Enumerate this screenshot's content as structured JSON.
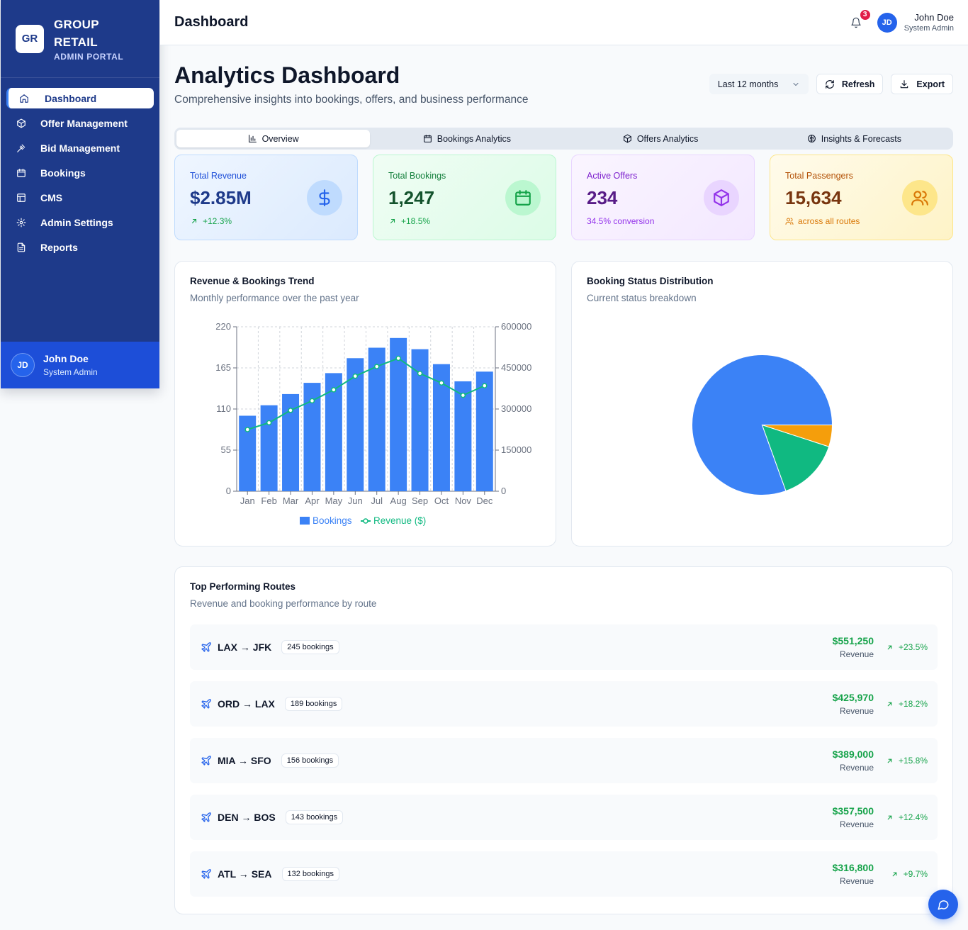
{
  "brand": {
    "logo": "GR",
    "name_line1": "GROUP",
    "name_line2": "RETAIL",
    "subtitle": "ADMIN PORTAL"
  },
  "sidebar": {
    "items": [
      {
        "label": "Dashboard",
        "icon": "home-icon",
        "active": true
      },
      {
        "label": "Offer Management",
        "icon": "package-icon"
      },
      {
        "label": "Bid Management",
        "icon": "gavel-icon"
      },
      {
        "label": "Bookings",
        "icon": "calendar-icon"
      },
      {
        "label": "CMS",
        "icon": "layout-icon"
      },
      {
        "label": "Admin Settings",
        "icon": "gear-icon"
      },
      {
        "label": "Reports",
        "icon": "file-icon"
      }
    ],
    "user": {
      "initials": "JD",
      "name": "John Doe",
      "role": "System Admin"
    }
  },
  "header": {
    "title": "Dashboard",
    "notifications": "3",
    "user": {
      "initials": "JD",
      "name": "John Doe",
      "role": "System Admin"
    }
  },
  "page": {
    "title": "Analytics Dashboard",
    "subtitle": "Comprehensive insights into bookings, offers, and business performance",
    "range_select": "Last 12 months",
    "refresh_label": "Refresh",
    "export_label": "Export"
  },
  "tabs": [
    {
      "label": "Overview",
      "icon": "bar-chart-icon",
      "active": true
    },
    {
      "label": "Bookings Analytics",
      "icon": "calendar-icon"
    },
    {
      "label": "Offers Analytics",
      "icon": "package-icon"
    },
    {
      "label": "Insights & Forecasts",
      "icon": "brain-icon"
    }
  ],
  "kpis": [
    {
      "label": "Total Revenue",
      "value": "$2.85M",
      "sub": "+12.3%",
      "icon": "dollar-icon"
    },
    {
      "label": "Total Bookings",
      "value": "1,247",
      "sub": "+18.5%",
      "icon": "calendar-icon"
    },
    {
      "label": "Active Offers",
      "value": "234",
      "sub": "34.5% conversion",
      "icon": "package-icon"
    },
    {
      "label": "Total Passengers",
      "value": "15,634",
      "sub": "across all routes",
      "icon": "users-icon"
    }
  ],
  "trend_card": {
    "title": "Revenue & Bookings Trend",
    "subtitle": "Monthly performance over the past year"
  },
  "status_card": {
    "title": "Booking Status Distribution",
    "subtitle": "Current status breakdown"
  },
  "chart_data": [
    {
      "type": "bar",
      "categories": [
        "Jan",
        "Feb",
        "Mar",
        "Apr",
        "May",
        "Jun",
        "Jul",
        "Aug",
        "Sep",
        "Oct",
        "Nov",
        "Dec"
      ],
      "series": [
        {
          "name": "Bookings",
          "type": "bar",
          "axis": "left",
          "color": "#3b82f6",
          "values": [
            101,
            115,
            130,
            145,
            158,
            178,
            192,
            205,
            190,
            170,
            147,
            160
          ]
        },
        {
          "name": "Revenue ($)",
          "type": "line",
          "axis": "right",
          "color": "#10b981",
          "values": [
            225000,
            250000,
            295000,
            330000,
            370000,
            420000,
            455000,
            485000,
            430000,
            395000,
            350000,
            385000
          ]
        }
      ],
      "left_ticks": [
        0,
        55,
        110,
        165,
        220
      ],
      "right_ticks": [
        0,
        150000,
        300000,
        450000,
        600000
      ],
      "ylim_left": [
        0,
        220
      ],
      "ylim_right": [
        0,
        600000
      ],
      "grid": true,
      "legend": "bottom"
    },
    {
      "type": "pie",
      "slices": [
        {
          "value": 80.5,
          "color": "#3b82f6"
        },
        {
          "value": 14.5,
          "color": "#10b981"
        },
        {
          "value": 5.0,
          "color": "#f59e0b"
        }
      ],
      "legend": "none"
    }
  ],
  "routes_card": {
    "title": "Top Performing Routes",
    "subtitle": "Revenue and booking performance by route",
    "revenue_label": "Revenue",
    "routes": [
      {
        "name": "LAX → JFK",
        "bookings": "245 bookings",
        "revenue": "$551,250",
        "change": "+23.5%"
      },
      {
        "name": "ORD → LAX",
        "bookings": "189 bookings",
        "revenue": "$425,970",
        "change": "+18.2%"
      },
      {
        "name": "MIA → SFO",
        "bookings": "156 bookings",
        "revenue": "$389,000",
        "change": "+15.8%"
      },
      {
        "name": "DEN → BOS",
        "bookings": "143 bookings",
        "revenue": "$357,500",
        "change": "+12.4%"
      },
      {
        "name": "ATL → SEA",
        "bookings": "132 bookings",
        "revenue": "$316,800",
        "change": "+9.7%"
      }
    ]
  }
}
